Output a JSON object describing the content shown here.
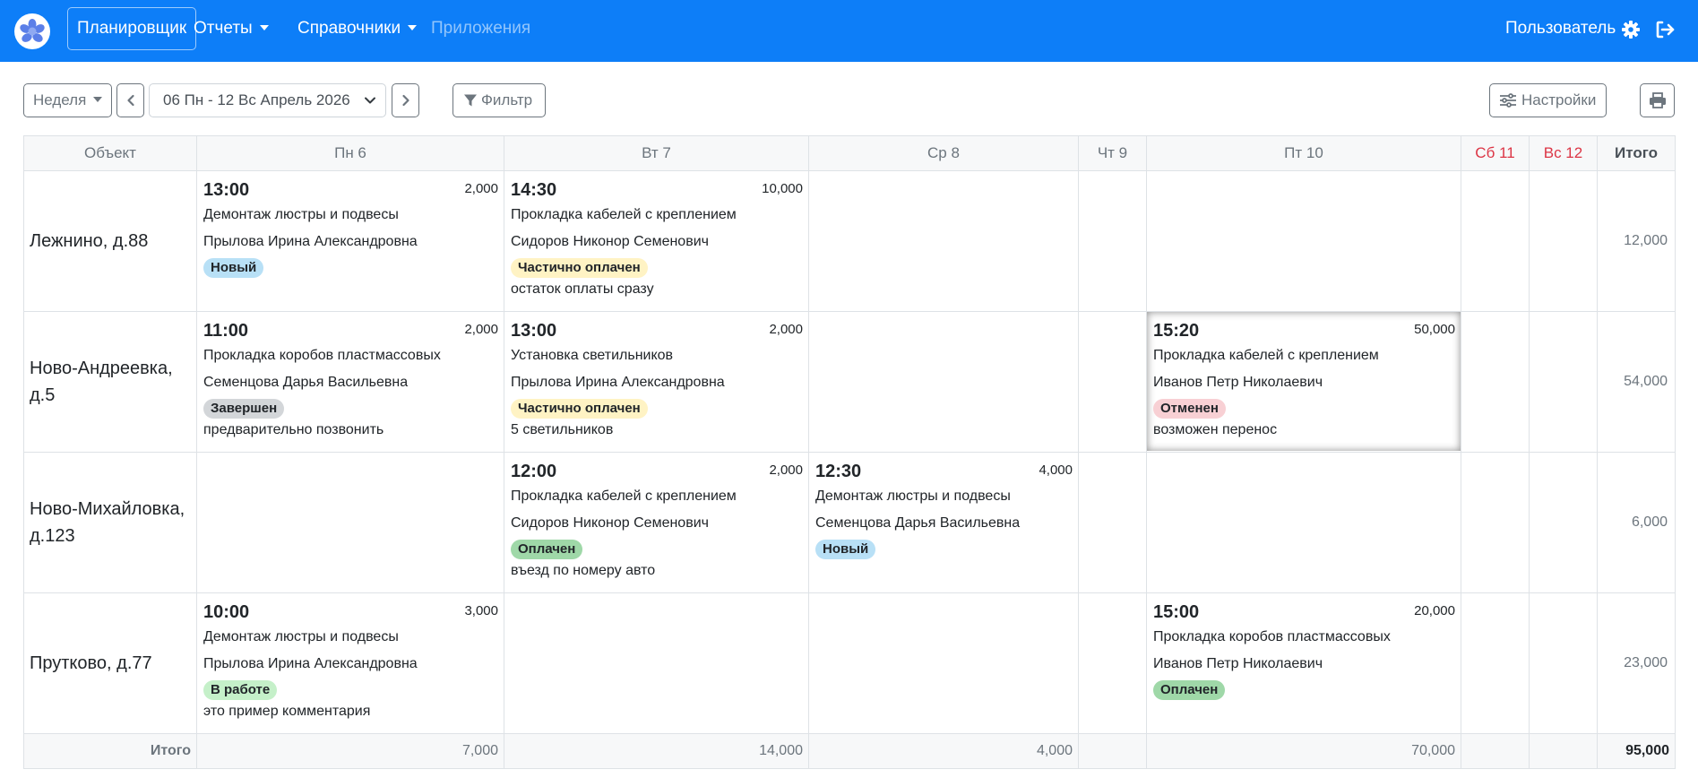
{
  "nav": {
    "planner": "Планировщик",
    "reports": "Отчеты",
    "directories": "Справочники",
    "apps": "Приложения",
    "user": "Пользователь",
    "icons": [
      "app-logo-icon",
      "gear-icon",
      "sign-out-icon"
    ]
  },
  "toolbar": {
    "view": "Неделя",
    "date_range": "06 Пн - 12 Вс Апрель 2026",
    "filter": "Фильтр",
    "settings": "Настройки"
  },
  "table": {
    "headers": [
      "Объект",
      "Пн 6",
      "Вт 7",
      "Ср 8",
      "Чт 9",
      "Пт 10",
      "Сб 11",
      "Вс 12",
      "Итого"
    ],
    "rows": [
      {
        "object": "Лежнино, д.88",
        "total": "12,000",
        "cells": [
          {
            "time": "13:00",
            "amount": "2,000",
            "work": "Демонтаж люстры и подвесы",
            "person": "Прылова Ирина Александровна",
            "status": "Новый",
            "note": ""
          },
          {
            "time": "14:30",
            "amount": "10,000",
            "work": "Прокладка кабелей с креплением",
            "person": "Сидоров Никонор Семенович",
            "status": "Частично оплачен",
            "note": "остаток оплаты сразу"
          },
          null,
          null,
          null,
          null,
          null
        ]
      },
      {
        "object": "Ново-Андреевка, д.5",
        "total": "54,000",
        "cells": [
          {
            "time": "11:00",
            "amount": "2,000",
            "work": "Прокладка коробов пластмассовых",
            "person": "Семенцова Дарья Васильевна",
            "status": "Завершен",
            "note": "предварительно позвонить"
          },
          {
            "time": "13:00",
            "amount": "2,000",
            "work": "Установка светильников",
            "person": "Прылова Ирина Александровна",
            "status": "Частично оплачен",
            "note": "5 светильников"
          },
          null,
          null,
          {
            "time": "15:20",
            "amount": "50,000",
            "work": "Прокладка кабелей с креплением",
            "person": "Иванов Петр Николаевич",
            "status": "Отменен",
            "note": "возможен перенос"
          },
          null,
          null
        ]
      },
      {
        "object": "Ново-Михайловка, д.123",
        "total": "6,000",
        "cells": [
          null,
          {
            "time": "12:00",
            "amount": "2,000",
            "work": "Прокладка кабелей с креплением",
            "person": "Сидоров Никонор Семенович",
            "status": "Оплачен",
            "note": "въезд по номеру авто"
          },
          {
            "time": "12:30",
            "amount": "4,000",
            "work": "Демонтаж люстры и подвесы",
            "person": "Семенцова Дарья Васильевна",
            "status": "Новый",
            "note": ""
          },
          null,
          null,
          null,
          null
        ]
      },
      {
        "object": "Прутково, д.77",
        "total": "23,000",
        "cells": [
          {
            "time": "10:00",
            "amount": "3,000",
            "work": "Демонтаж люстры и подвесы",
            "person": "Прылова Ирина Александровна",
            "status": "В работе",
            "note": "это пример комментария"
          },
          null,
          null,
          null,
          {
            "time": "15:00",
            "amount": "20,000",
            "work": "Прокладка коробов пластмассовых",
            "person": "Иванов Петр Николаевич",
            "status": "Оплачен",
            "note": ""
          },
          null,
          null
        ]
      }
    ],
    "footer": {
      "label": "Итого",
      "values": [
        "7,000",
        "14,000",
        "4,000",
        "",
        "70,000",
        "",
        ""
      ],
      "grand": "95,000"
    }
  },
  "status_colors": {
    "Новый": "#b8e0f6",
    "Частично оплачен": "#fff3c4",
    "Завершен": "#d3d6d9",
    "Отменен": "#f8d0d4",
    "Оплачен": "#9fd8a8",
    "В работе": "#c5f0c9"
  },
  "colors": {
    "navbar": "#0d7ef8",
    "weekend_header": "#dc3545"
  }
}
